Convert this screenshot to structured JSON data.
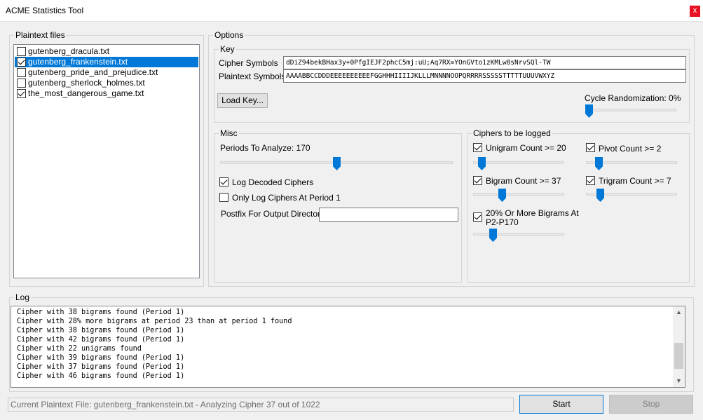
{
  "window": {
    "title": "ACME Statistics Tool",
    "close_glyph": "x"
  },
  "plaintext": {
    "group_label": "Plaintext files",
    "files": [
      {
        "name": "gutenberg_dracula.txt",
        "checked": false,
        "selected": false
      },
      {
        "name": "gutenberg_frankenstein.txt",
        "checked": true,
        "selected": true
      },
      {
        "name": "gutenberg_pride_and_prejudice.txt",
        "checked": false,
        "selected": false
      },
      {
        "name": "gutenberg_sherlock_holmes.txt",
        "checked": false,
        "selected": false
      },
      {
        "name": "the_most_dangerous_game.txt",
        "checked": true,
        "selected": false
      }
    ]
  },
  "options": {
    "group_label": "Options",
    "key": {
      "group_label": "Key",
      "cipher_label": "Cipher Symbols",
      "cipher_value": "dDiZ94bekBHax3y+0PfgIEJF2phcC5mj:uU;Aq7RX=YOnGVto1zKMLw8sNrvSQl-TW",
      "plain_label": "Plaintext Symbols",
      "plain_value": "AAAABBCCDDDEEEEEEEEEEFGGHHHIIIIJKLLLMNNNNOOPQRRRRSSSSSTTTTTUUUVWXYZ",
      "load_button": "Load Key...",
      "cycle_label": "Cycle Randomization: 0%",
      "cycle_value_percent": 0
    },
    "misc": {
      "group_label": "Misc",
      "periods_label": "Periods To Analyze: 170",
      "log_decoded_label": "Log Decoded Ciphers",
      "log_decoded_checked": true,
      "only_period1_label": "Only Log Ciphers At Period 1",
      "only_period1_checked": false,
      "postfix_label": "Postfix For Output Directory",
      "postfix_value": ""
    },
    "ciphers_logged": {
      "group_label": "Ciphers to be logged",
      "unigram_label": "Unigram Count >= 20",
      "unigram_checked": true,
      "pivot_label": "Pivot Count >= 2",
      "pivot_checked": true,
      "bigram_label": "Bigram Count >= 37",
      "bigram_checked": true,
      "trigram_label": "Trigram Count >= 7",
      "trigram_checked": true,
      "bigram_pct_label_1": "20% Or More Bigrams At",
      "bigram_pct_label_2": "P2-P170",
      "bigram_pct_checked": true
    }
  },
  "log": {
    "group_label": "Log",
    "lines": [
      "Cipher with 38 bigrams found (Period 1)",
      "Cipher with 28% more bigrams at period 23 than at period 1 found",
      "Cipher with 38 bigrams found (Period 1)",
      "Cipher with 42 bigrams found (Period 1)",
      "Cipher with 22 unigrams found",
      "Cipher with 39 bigrams found (Period 1)",
      "Cipher with 37 bigrams found (Period 1)",
      "Cipher with 46 bigrams found (Period 1)"
    ]
  },
  "footer": {
    "status_text": "Current Plaintext File: gutenberg_frankenstein.txt - Analyzing Cipher 37 out of 1022",
    "start_button": "Start",
    "stop_button": "Stop"
  },
  "colors": {
    "accent": "#0078d7",
    "close_red": "#e81123"
  }
}
